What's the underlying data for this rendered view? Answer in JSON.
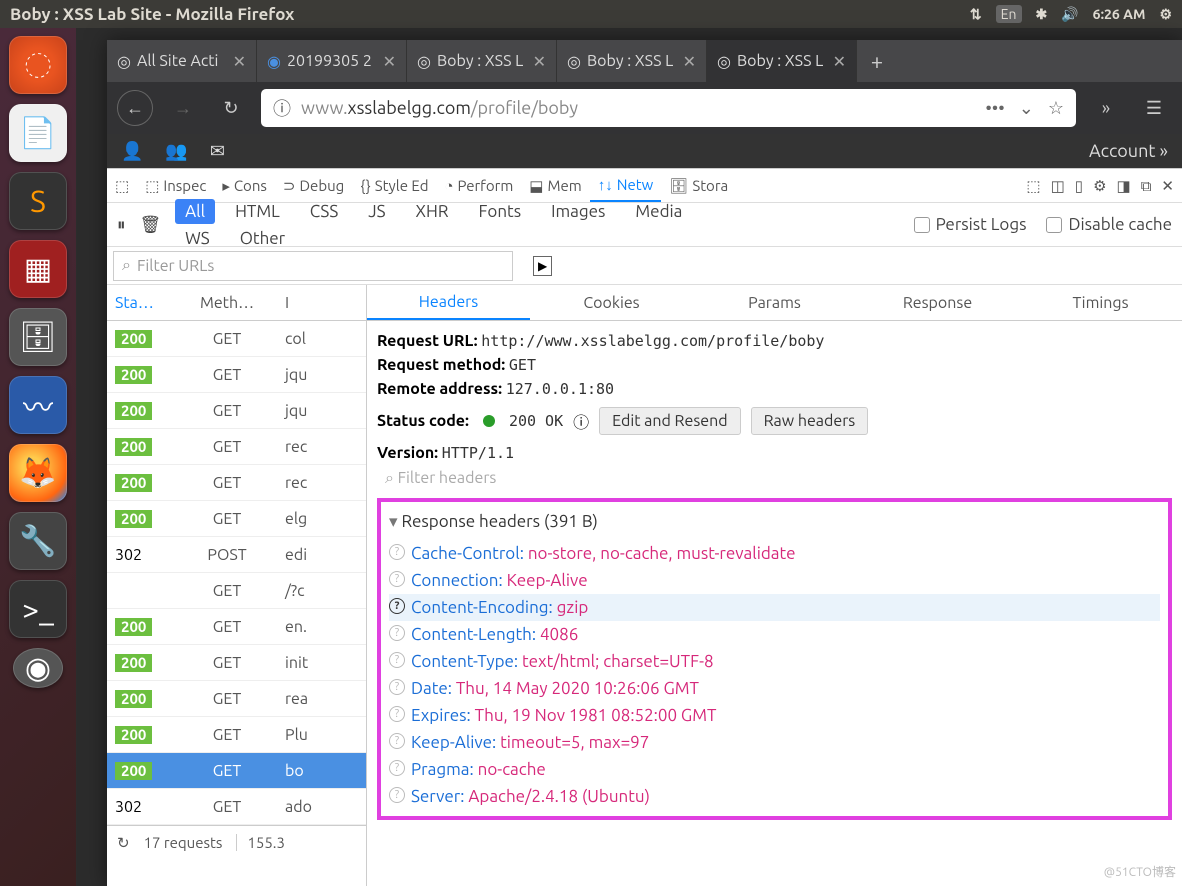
{
  "topbar": {
    "title": "Boby : XSS Lab Site - Mozilla Firefox",
    "lang": "En",
    "time": "6:26 AM"
  },
  "tabs": [
    {
      "label": "All Site Acti"
    },
    {
      "label": "20199305 2"
    },
    {
      "label": "Boby : XSS L"
    },
    {
      "label": "Boby : XSS L"
    },
    {
      "label": "Boby : XSS L",
      "active": true
    }
  ],
  "url": {
    "prefix": "www.",
    "host": "xsslabelgg.com",
    "path": "/profile/boby"
  },
  "elgg": {
    "account": "Account »"
  },
  "devtools": {
    "tabs": [
      "Inspec",
      "Cons",
      "Debug",
      "Style Ed",
      "Perform",
      "Mem",
      "Netw",
      "Stora"
    ],
    "active_tab": "Netw",
    "filters": {
      "pills": [
        "All",
        "HTML",
        "CSS",
        "JS",
        "XHR",
        "Fonts",
        "Images",
        "Media",
        "WS",
        "Other"
      ],
      "active": "All",
      "persist": "Persist Logs",
      "disable": "Disable cache"
    },
    "url_filter_placeholder": "Filter URLs",
    "requests": {
      "cols": [
        "Sta…",
        "Meth…",
        "I"
      ],
      "rows": [
        {
          "status": "200",
          "method": "GET",
          "file": "col"
        },
        {
          "status": "200",
          "method": "GET",
          "file": "jqu"
        },
        {
          "status": "200",
          "method": "GET",
          "file": "jqu"
        },
        {
          "status": "200",
          "method": "GET",
          "file": "rec"
        },
        {
          "status": "200",
          "method": "GET",
          "file": "rec"
        },
        {
          "status": "200",
          "method": "GET",
          "file": "elg"
        },
        {
          "status": "302",
          "method": "POST",
          "file": "edi",
          "plain": true
        },
        {
          "status": "",
          "method": "GET",
          "file": "/?c"
        },
        {
          "status": "200",
          "method": "GET",
          "file": "en."
        },
        {
          "status": "200",
          "method": "GET",
          "file": "init"
        },
        {
          "status": "200",
          "method": "GET",
          "file": "rea"
        },
        {
          "status": "200",
          "method": "GET",
          "file": "Plu"
        },
        {
          "status": "200",
          "method": "GET",
          "file": "bo",
          "selected": true
        },
        {
          "status": "302",
          "method": "GET",
          "file": "ado",
          "plain": true
        }
      ],
      "footer": {
        "count": "17 requests",
        "size": "155.3"
      }
    },
    "details": {
      "tabs": [
        "Headers",
        "Cookies",
        "Params",
        "Response",
        "Timings"
      ],
      "active": "Headers",
      "request_url_label": "Request URL:",
      "request_url": "http://www.xsslabelgg.com/profile/boby",
      "request_method_label": "Request method:",
      "request_method": "GET",
      "remote_label": "Remote address:",
      "remote": "127.0.0.1:80",
      "status_label": "Status code:",
      "status": "200 OK",
      "edit": "Edit and Resend",
      "raw": "Raw headers",
      "version_label": "Version:",
      "version": "HTTP/1.1",
      "filter_headers": "Filter headers",
      "response_title": "Response headers (391 B)",
      "response_headers": [
        {
          "k": "Cache-Control:",
          "v": "no-store, no-cache, must-revalidate"
        },
        {
          "k": "Connection:",
          "v": "Keep-Alive"
        },
        {
          "k": "Content-Encoding:",
          "v": "gzip",
          "hl": true
        },
        {
          "k": "Content-Length:",
          "v": "4086"
        },
        {
          "k": "Content-Type:",
          "v": "text/html; charset=UTF-8"
        },
        {
          "k": "Date:",
          "v": "Thu, 14 May 2020 10:26:06 GMT"
        },
        {
          "k": "Expires:",
          "v": "Thu, 19 Nov 1981 08:52:00 GMT"
        },
        {
          "k": "Keep-Alive:",
          "v": "timeout=5, max=97"
        },
        {
          "k": "Pragma:",
          "v": "no-cache"
        },
        {
          "k": "Server:",
          "v": "Apache/2.4.18 (Ubuntu)"
        }
      ]
    }
  },
  "watermark": "@51CTO博客"
}
